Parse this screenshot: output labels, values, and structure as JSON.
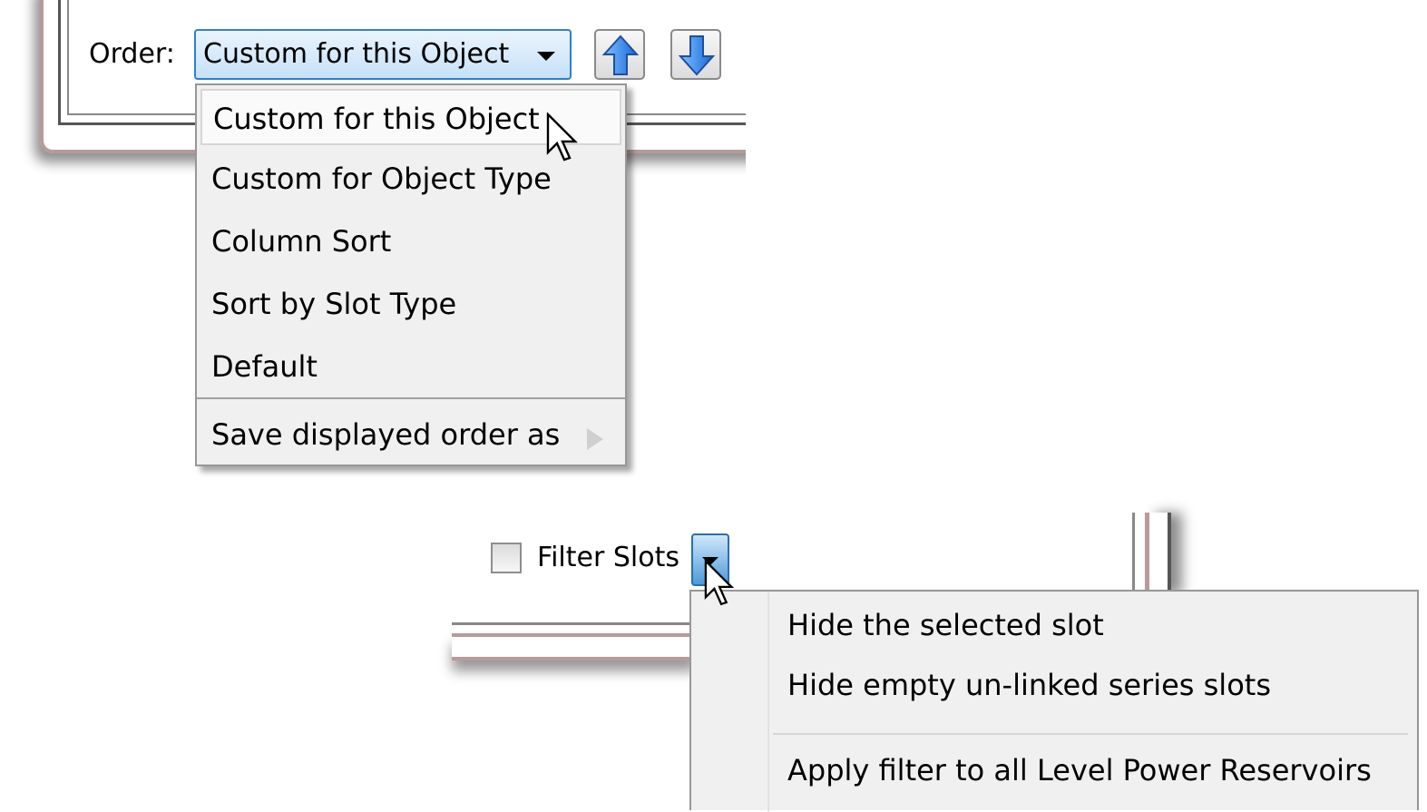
{
  "order_section": {
    "label": "Order:",
    "selected": "Custom for this Object",
    "dropdown_items": [
      "Custom for this Object",
      "Custom for Object Type",
      "Column Sort",
      "Sort by Slot Type",
      "Default"
    ],
    "save_item": "Save displayed order as"
  },
  "filter_section": {
    "checkbox_label": "Filter Slots",
    "checked": false,
    "menu_items": [
      "Hide the selected slot",
      "Hide empty un-linked series slots"
    ],
    "apply_item": "Apply filter to all Level Power Reservoirs"
  },
  "colors": {
    "frame_maroon": "#b89a9a",
    "menu_bg": "#f0f0f0",
    "combo_border": "#2f7fd2",
    "arrow_blue": "#2b7de9"
  }
}
